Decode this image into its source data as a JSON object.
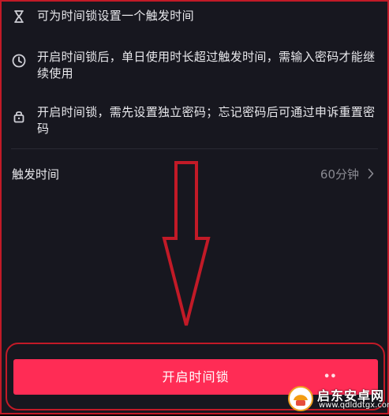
{
  "info_items": [
    {
      "icon": "hourglass-icon",
      "text": "可为时间锁设置一个触发时间"
    },
    {
      "icon": "clock-icon",
      "text": "开启时间锁后，单日使用时长超过触发时间，需输入密码才能继续使用"
    },
    {
      "icon": "lock-icon",
      "text": "开启时间锁，需先设置独立密码；忘记密码后可通过申诉重置密码"
    }
  ],
  "trigger_setting": {
    "label": "触发时间",
    "value": "60分钟",
    "icon": "chevron-right-icon"
  },
  "primary_button": {
    "label": "开启时间锁"
  },
  "watermark": {
    "title": "启东安卓网",
    "url": "www.qdlddtgx.com"
  },
  "colors": {
    "background": "#17171f",
    "primary": "#ff2c55",
    "annotation": "#c21a27",
    "text": "#e8e8ec",
    "muted_text": "#8a8a92"
  }
}
